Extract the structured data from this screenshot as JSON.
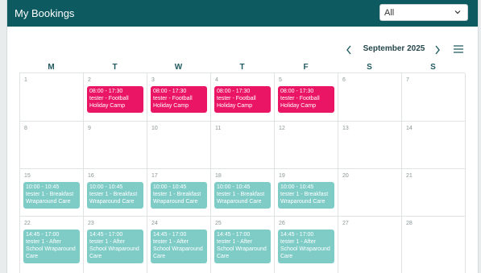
{
  "header": {
    "title": "My Bookings"
  },
  "filter": {
    "selected": "All",
    "chevron_icon": "chevron-down-icon"
  },
  "calendar": {
    "month_label": "September 2025",
    "prev_icon": "chevron-left-icon",
    "next_icon": "chevron-right-icon",
    "menu_icon": "hamburger-menu-icon",
    "weekdays": [
      "M",
      "T",
      "W",
      "T",
      "F",
      "S",
      "S"
    ],
    "weeks": [
      [
        "1",
        "2",
        "3",
        "4",
        "5",
        "6",
        "7"
      ],
      [
        "8",
        "9",
        "10",
        "11",
        "12",
        "13",
        "14"
      ],
      [
        "15",
        "16",
        "17",
        "18",
        "19",
        "20",
        "21"
      ],
      [
        "22",
        "23",
        "24",
        "25",
        "26",
        "27",
        "28"
      ]
    ],
    "events": {
      "football": {
        "time": "08:00 - 17:30",
        "line1": "tester - Football",
        "line2": "Holiday Camp",
        "color": "#ea1565"
      },
      "breakfast": {
        "time": "10:00 - 10:45",
        "line1": "tester 1 - Breakfast",
        "line2": "Wraparound Care",
        "color": "#7fccc7"
      },
      "afterschool": {
        "time": "14:45 - 17:00",
        "line1": "tester 1 - After",
        "line2": "School Wraparound",
        "line3": "Care",
        "color": "#7fccc7"
      }
    }
  }
}
